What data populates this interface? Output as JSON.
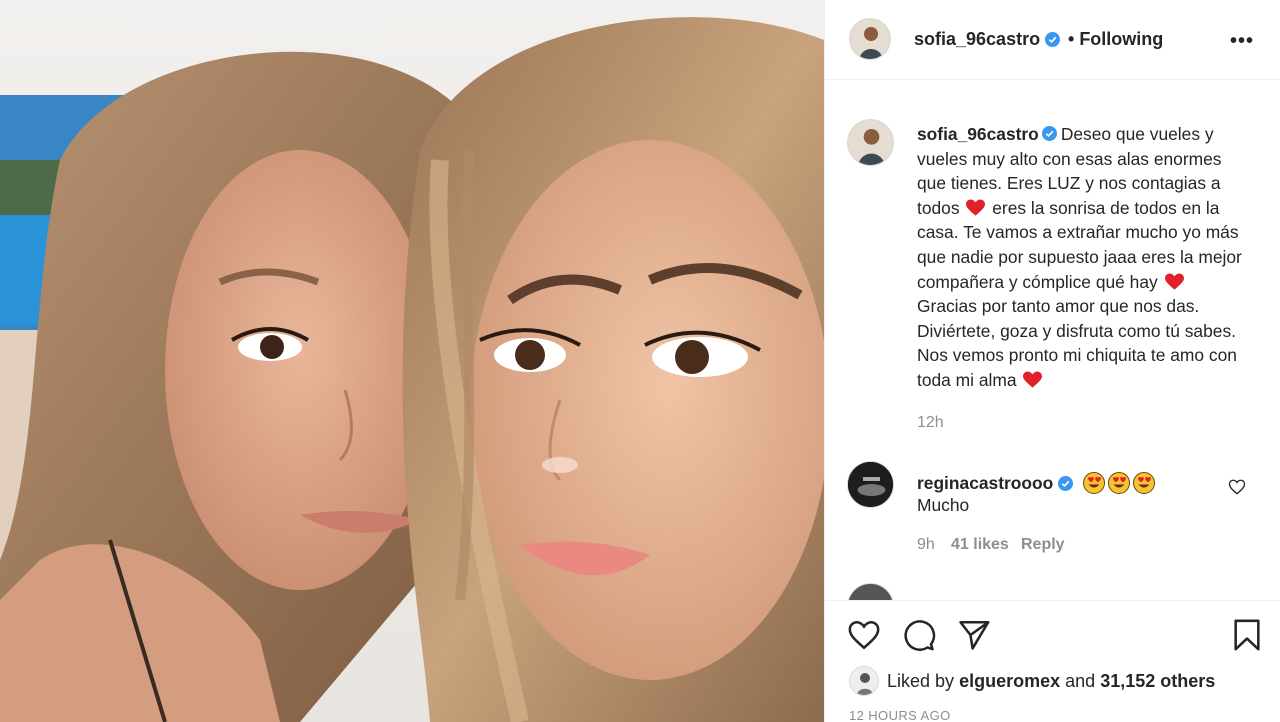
{
  "post": {
    "author": "sofia_96castro",
    "follow_status": "Following",
    "more_label": "•••",
    "caption_parts": [
      "Deseo que vueles y vueles muy alto con esas alas enormes que tienes. Eres LUZ y nos contagias a todos",
      "eres la sonrisa de todos en la casa. Te vamos a extrañar mucho yo más que nadie por supuesto jaaa eres la mejor compañera y cómplice qué hay",
      "Gracias por tanto amor que nos das. Diviértete, goza y disfruta como tú sabes. Nos vemos pronto mi chiquita te amo con toda mi alma"
    ],
    "caption_time": "12h",
    "liked_by_prefix": "Liked by",
    "liked_by_user": "elgueromex",
    "liked_by_and": "and",
    "liked_by_others": "31,152 others",
    "age": "12 HOURS AGO"
  },
  "comments": [
    {
      "user": "reginacastroooo",
      "emojis": [
        "heart-eyes",
        "heart-eyes",
        "heart-eyes"
      ],
      "text": "Mucho",
      "time": "9h",
      "likes": "41 likes",
      "reply": "Reply"
    }
  ],
  "colors": {
    "verified": "#3897f0",
    "heart": "#e0202a",
    "muted": "#8e8e8e",
    "text": "#262626"
  },
  "icons": [
    "heart-icon",
    "comment-icon",
    "share-icon",
    "bookmark-icon",
    "verified-icon",
    "more-icon"
  ]
}
